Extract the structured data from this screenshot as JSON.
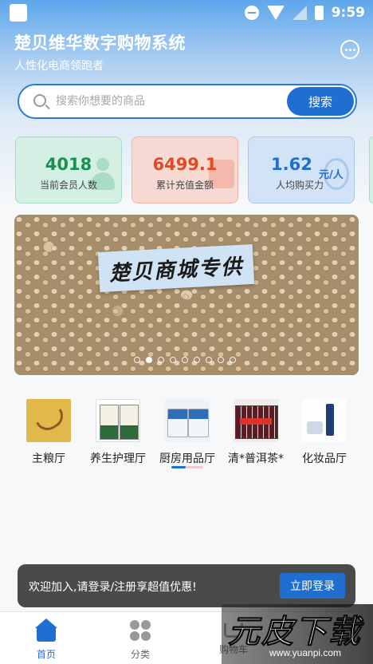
{
  "status_bar": {
    "time": "9:59"
  },
  "header": {
    "title": "楚贝维华数字购物系统",
    "subtitle": "人性化电商领跑者"
  },
  "search": {
    "placeholder": "搜索你想要的商品",
    "button_label": "搜索"
  },
  "stats": [
    {
      "value": "4018",
      "label": "当前会员人数",
      "color": "#17924f"
    },
    {
      "value": "6499.1",
      "label": "累计充值金额",
      "color": "#e04b23"
    },
    {
      "value": "1.62",
      "unit": "元/人",
      "label": "人均购买力",
      "color": "#1f6fd1"
    }
  ],
  "banner": {
    "text": "楚贝商城专供",
    "dot_count": 9,
    "active_dot": 1
  },
  "categories": [
    {
      "label": "主粮厅",
      "icon": "grain-image"
    },
    {
      "label": "养生护理厅",
      "icon": "health-image"
    },
    {
      "label": "厨房用品厅",
      "icon": "kitchen-image"
    },
    {
      "label": "清*普洱茶*",
      "icon": "tea-image"
    },
    {
      "label": "化妆品厅",
      "icon": "cosmetics-image"
    }
  ],
  "login_toast": {
    "message": "欢迎加入,请登录/注册享超值优惠!",
    "button_label": "立即登录"
  },
  "bottom_nav": [
    {
      "label": "首页",
      "icon": "home-icon",
      "active": true
    },
    {
      "label": "分类",
      "icon": "category-icon",
      "active": false
    },
    {
      "label": "购物车",
      "icon": "cart-icon",
      "active": false
    }
  ],
  "watermark": {
    "text": "元皮下载",
    "url": "www.yuanpi.com"
  },
  "colors": {
    "accent": "#1f6fd1",
    "header_gradient_top": "#5ea6ea"
  }
}
